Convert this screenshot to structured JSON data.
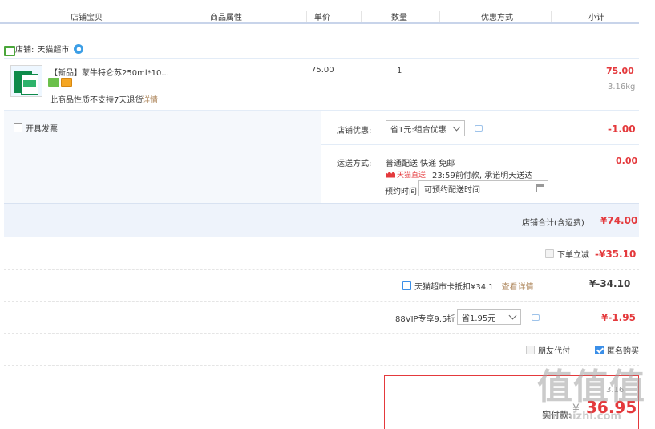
{
  "header": {
    "col_product": "店铺宝贝",
    "col_attr": "商品属性",
    "col_price": "单价",
    "col_qty": "数量",
    "col_discount": "优惠方式",
    "col_subtotal": "小计"
  },
  "shop": {
    "label": "店铺:",
    "name": "天猫超市"
  },
  "item": {
    "title": "【新品】蒙牛特仑苏250ml*10...",
    "price": "75.00",
    "qty": "1",
    "subtotal": "75.00",
    "weight": "3.16kg",
    "return_note": "此商品性质不支持7天退货",
    "detail_link": "详情"
  },
  "invoice": {
    "label": "开具发票"
  },
  "shop_discount": {
    "label": "店铺优惠:",
    "selected": "省1元:组合优惠",
    "amount": "-1.00"
  },
  "shipping": {
    "label": "运送方式:",
    "method": "普通配送 快递 免邮",
    "tmall_tag": "天猫直送",
    "promise": "23:59前付款, 承诺明天送达",
    "appt_label": "预约时间",
    "appt_value": "可预约配送时间",
    "amount": "0.00"
  },
  "shop_total": {
    "label": "店铺合计(含运费)",
    "amount": "¥74.00"
  },
  "instant_discount": {
    "label": "下单立减",
    "amount": "-¥35.10"
  },
  "card_deduct": {
    "label": "天猫超市卡抵扣¥34.1",
    "link": "查看详情",
    "amount": "¥-34.10"
  },
  "vip": {
    "label": "88VIP专享9.5折",
    "selected": "省1.95元",
    "amount": "¥-1.95"
  },
  "options": {
    "friend_pay": "朋友代付",
    "anonymous": "匿名购买"
  },
  "summary": {
    "total_label": "实付款:",
    "currency": "¥",
    "total": "36.95",
    "partial_hidden": "3.16"
  },
  "watermark": {
    "logo": "值",
    "url": "zhizhizhi.com"
  },
  "colors": {
    "accent_red": "#e4393c",
    "link_blue": "#3b8fe8",
    "header_line": "#c8d4ea"
  }
}
